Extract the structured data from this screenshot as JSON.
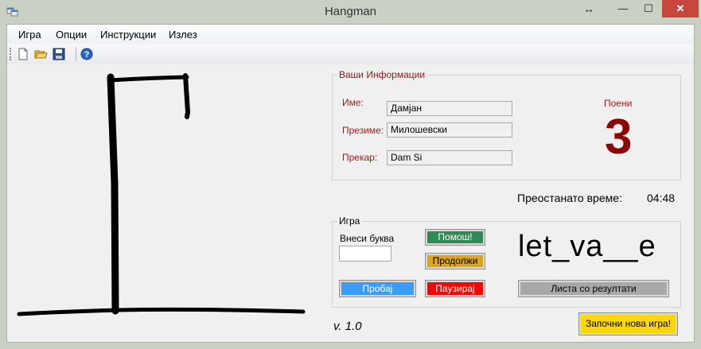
{
  "window": {
    "title": "Hangman",
    "resize_glyph": "↔",
    "min_glyph": "—",
    "max_glyph": "☐",
    "close_glyph": "✕"
  },
  "menu": {
    "items": [
      "Игра",
      "Опции",
      "Инструкции",
      "Излез"
    ]
  },
  "toolbar": {
    "icons": [
      "new-file-icon",
      "open-folder-icon",
      "save-icon",
      "help-icon"
    ]
  },
  "info": {
    "legend": "Ваши Информации",
    "name_label": "Име:",
    "name_value": "Дамјан",
    "surname_label": "Презиме:",
    "surname_value": "Милошевски",
    "nickname_label": "Прекар:",
    "nickname_value": "Dam Si",
    "score_label": "Поени",
    "score_value": "3"
  },
  "timer": {
    "label": "Преостанато време:",
    "value": "04:48"
  },
  "game": {
    "legend": "Игра",
    "enter_letter_label": "Внеси буква",
    "letter_value": "",
    "help_button": "Помош!",
    "continue_button": "Продолжи",
    "try_button": "Пробај",
    "pause_button": "Паузирај",
    "word": "let_va__e",
    "results_button": "Листа со резултати"
  },
  "version": "v. 1.0",
  "new_game_button": "Започни нова игра!",
  "colors": {
    "help_bg": "#2e8b57",
    "continue_bg": "#daa520",
    "try_bg": "#3c9cf5",
    "pause_bg": "#ff0000",
    "results_bg": "#a8a8a8",
    "new_game_bg": "#ffd700",
    "label_red": "#9b1c1c",
    "score": "#8b0000"
  }
}
